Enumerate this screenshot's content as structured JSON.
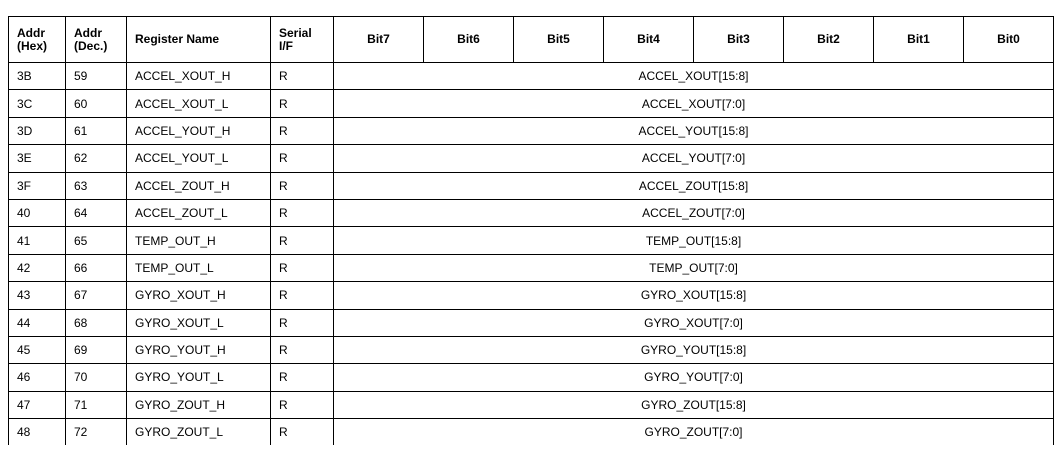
{
  "table": {
    "headers": {
      "addr_hex": [
        "Addr",
        "(Hex)"
      ],
      "addr_dec": [
        "Addr",
        "(Dec.)"
      ],
      "register_name": "Register Name",
      "serial_if": [
        "Serial",
        "I/F"
      ],
      "bits": [
        "Bit7",
        "Bit6",
        "Bit5",
        "Bit4",
        "Bit3",
        "Bit2",
        "Bit1",
        "Bit0"
      ]
    },
    "rows": [
      {
        "hex": "3B",
        "dec": "59",
        "name": "ACCEL_XOUT_H",
        "serial": "R",
        "bits": "ACCEL_XOUT[15:8]"
      },
      {
        "hex": "3C",
        "dec": "60",
        "name": "ACCEL_XOUT_L",
        "serial": "R",
        "bits": "ACCEL_XOUT[7:0]"
      },
      {
        "hex": "3D",
        "dec": "61",
        "name": "ACCEL_YOUT_H",
        "serial": "R",
        "bits": "ACCEL_YOUT[15:8]"
      },
      {
        "hex": "3E",
        "dec": "62",
        "name": "ACCEL_YOUT_L",
        "serial": "R",
        "bits": "ACCEL_YOUT[7:0]"
      },
      {
        "hex": "3F",
        "dec": "63",
        "name": "ACCEL_ZOUT_H",
        "serial": "R",
        "bits": "ACCEL_ZOUT[15:8]"
      },
      {
        "hex": "40",
        "dec": "64",
        "name": "ACCEL_ZOUT_L",
        "serial": "R",
        "bits": "ACCEL_ZOUT[7:0]"
      },
      {
        "hex": "41",
        "dec": "65",
        "name": "TEMP_OUT_H",
        "serial": "R",
        "bits": "TEMP_OUT[15:8]"
      },
      {
        "hex": "42",
        "dec": "66",
        "name": "TEMP_OUT_L",
        "serial": "R",
        "bits": "TEMP_OUT[7:0]"
      },
      {
        "hex": "43",
        "dec": "67",
        "name": "GYRO_XOUT_H",
        "serial": "R",
        "bits": "GYRO_XOUT[15:8]"
      },
      {
        "hex": "44",
        "dec": "68",
        "name": "GYRO_XOUT_L",
        "serial": "R",
        "bits": "GYRO_XOUT[7:0]"
      },
      {
        "hex": "45",
        "dec": "69",
        "name": "GYRO_YOUT_H",
        "serial": "R",
        "bits": "GYRO_YOUT[15:8]"
      },
      {
        "hex": "46",
        "dec": "70",
        "name": "GYRO_YOUT_L",
        "serial": "R",
        "bits": "GYRO_YOUT[7:0]"
      },
      {
        "hex": "47",
        "dec": "71",
        "name": "GYRO_ZOUT_H",
        "serial": "R",
        "bits": "GYRO_ZOUT[15:8]"
      },
      {
        "hex": "48",
        "dec": "72",
        "name": "GYRO_ZOUT_L",
        "serial": "R",
        "bits": "GYRO_ZOUT[7:0]"
      }
    ]
  }
}
